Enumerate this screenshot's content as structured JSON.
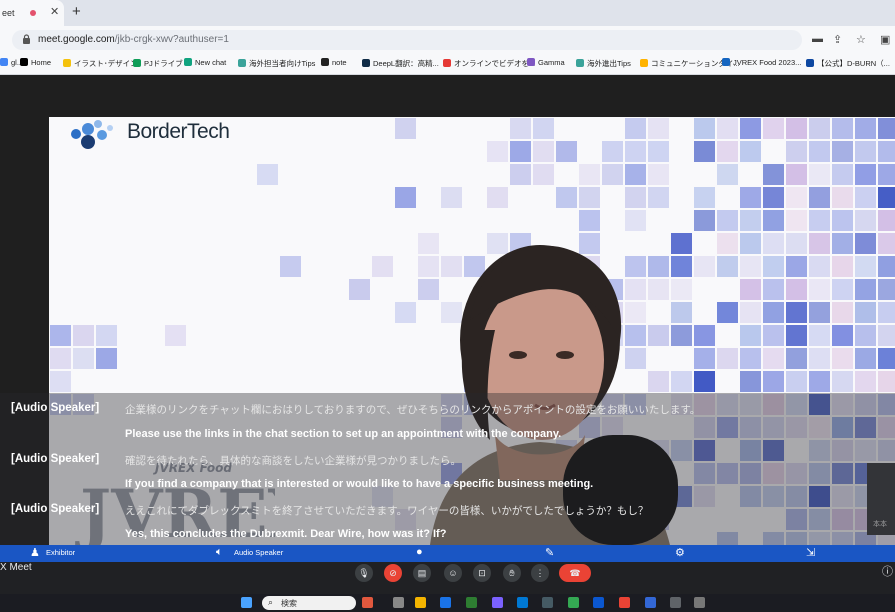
{
  "browser": {
    "tab": {
      "title": "Meet",
      "title_visible": "eet"
    },
    "address": {
      "host": "meet.google.com",
      "path": "/jkb-crgk-xwv?authuser=1"
    },
    "bookmarks": [
      {
        "label": "gl..",
        "color": "#4285f4"
      },
      {
        "label": "Home",
        "color": "#000000"
      },
      {
        "label": "イラスト･デザイン",
        "color": "#f4c20d"
      },
      {
        "label": "PJドライブ",
        "color": "#0f9d58"
      },
      {
        "label": "New chat",
        "color": "#10a37f"
      },
      {
        "label": "海外担当者向けTips",
        "color": "#3aa39a"
      },
      {
        "label": "note",
        "color": "#222222"
      },
      {
        "label": "DeepL翻訳：高精...",
        "color": "#0f2b46"
      },
      {
        "label": "オンラインでビデオを...",
        "color": "#e53935"
      },
      {
        "label": "Gamma",
        "color": "#7e57c2"
      },
      {
        "label": "海外進出Tips",
        "color": "#3aa39a"
      },
      {
        "label": "コミュニケーションダイ...",
        "color": "#ffb300"
      },
      {
        "label": "JVREX Food 2023...",
        "color": "#1565c0"
      },
      {
        "label": "【公式】D-BURN（...",
        "color": "#0d47a1"
      }
    ]
  },
  "slide": {
    "logo_text": "BorderTech",
    "watermark_text": "JVREX Food"
  },
  "captions": [
    {
      "speaker": "[Audio Speaker]",
      "ja": "企業様のリンクをチャット欄におはりしておりますので、ぜひそちらのリンクからアポイントの設定をお願いいたします。",
      "en": "Please use the links in the chat section to set up an appointment with the company."
    },
    {
      "speaker": "[Audio Speaker]",
      "ja": "確認を待たれたら、具体的な商談をしたい企業様が見つかりましたら。",
      "en": "If you find a company that is interested or would like to have a specific business meeting."
    },
    {
      "speaker": "[Audio Speaker]",
      "ja": "ええこれにてダブレックスミトを終了させていただきます。ワイヤーの皆様、いかがでしたでしょうか？もし？",
      "en": "Yes, this concludes the Dubrexmit. Dear Wire, how was it? If?"
    }
  ],
  "participant_thumb": {
    "name": "本本"
  },
  "caption_toolbar": {
    "exhibitor": "Exhibitor",
    "audio_speaker": "Audio Speaker"
  },
  "meet": {
    "name": "X Meet"
  },
  "taskbar": {
    "search_placeholder": "検索"
  },
  "icons": {
    "lock": "lock-icon",
    "camera": "camera-icon",
    "share": "share-icon",
    "star": "star-icon",
    "mic": "mic-icon",
    "cam_off": "camera-off-icon",
    "captions": "captions-icon",
    "emoji": "emoji-icon",
    "present": "present-icon",
    "hand": "raise-hand-icon",
    "more": "more-icon",
    "end": "end-call-icon",
    "info": "info-icon",
    "settings": "gear-icon"
  }
}
